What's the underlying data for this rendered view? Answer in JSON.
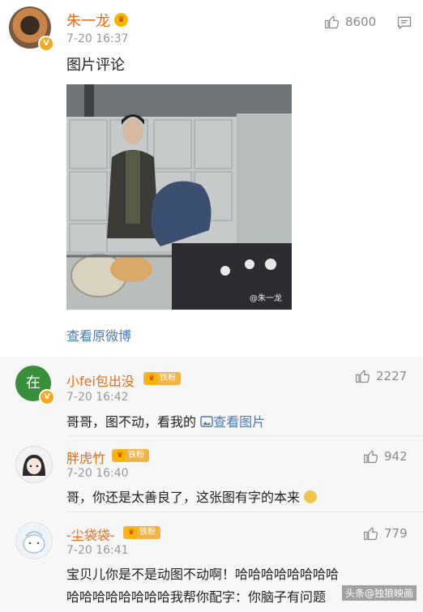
{
  "post": {
    "author": "朱一龙",
    "time": "7-20 16:37",
    "likes": "8600",
    "text": "图片评论",
    "image_watermark": "@朱一龙",
    "view_original": "查看原微博"
  },
  "comments": [
    {
      "name": "小fei包出没",
      "badge": "铁粉",
      "time": "7-20 16:42",
      "likes": "2227",
      "text": "哥哥，图不动，看我的",
      "link": "查看图片",
      "avatar_text": "在"
    },
    {
      "name": "胖虎竹",
      "badge": "铁粉",
      "time": "7-20 16:40",
      "likes": "942",
      "text": "哥，你还是太善良了，这张图有字的本来"
    },
    {
      "name": "-尘袋袋-",
      "badge": "铁粉",
      "time": "7-20 16:41",
      "likes": "779",
      "text_line1": "宝贝儿你是不是动图不动啊！哈哈哈哈哈哈哈哈",
      "text_line2": "哈哈哈哈哈哈哈哈我帮你配字：你脑子有问题"
    }
  ],
  "watermark": "头条@独狼映画",
  "colors": {
    "name_orange": "#e86c1a",
    "link_blue": "#4a79b4",
    "badge": "#f4b347"
  },
  "icons": [
    "thumbs-up-icon",
    "comment-icon",
    "verified-icon",
    "crown-icon",
    "image-icon"
  ]
}
